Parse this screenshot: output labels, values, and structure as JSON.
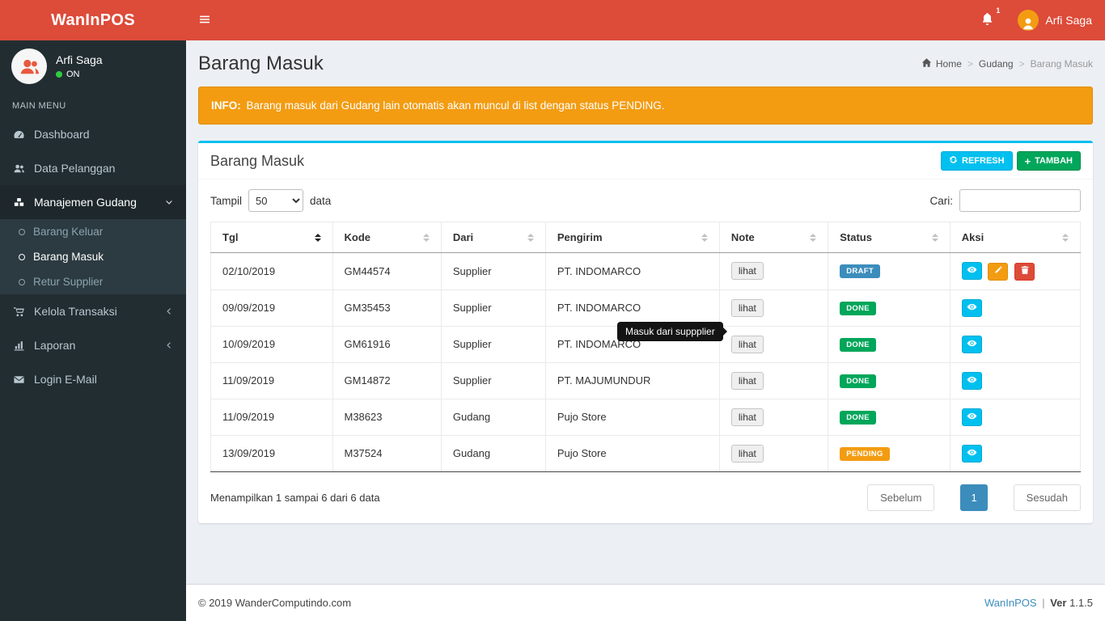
{
  "navbar": {
    "brand": "WanInPOS",
    "notification_count": "1",
    "user_name": "Arfi Saga"
  },
  "sidebar": {
    "user": {
      "name": "Arfi Saga",
      "status": "ON"
    },
    "section": "MAIN MENU",
    "items": [
      {
        "label": "Dashboard"
      },
      {
        "label": "Data Pelanggan"
      },
      {
        "label": "Manajemen Gudang"
      },
      {
        "label": "Kelola Transaksi"
      },
      {
        "label": "Laporan"
      },
      {
        "label": "Login E-Mail"
      }
    ],
    "gudang_children": [
      {
        "label": "Barang Keluar"
      },
      {
        "label": "Barang Masuk"
      },
      {
        "label": "Retur Supplier"
      }
    ]
  },
  "content": {
    "page_title": "Barang Masuk",
    "breadcrumb": {
      "home": "Home",
      "middle": "Gudang",
      "current": "Barang Masuk"
    },
    "alert": {
      "prefix": "INFO:",
      "text": "Barang masuk dari Gudang lain otomatis akan muncul di list dengan status PENDING."
    },
    "tooltip": "Masuk dari suppplier",
    "panel": {
      "title": "Barang Masuk",
      "refresh_label": "REFRESH",
      "tambah_label": "TAMBAH",
      "length_label": "Tampil",
      "length_value": "50",
      "length_suffix": "data",
      "search_label": "Cari:",
      "info": "Menampilkan 1 sampai 6 dari 6 data",
      "pagination": {
        "prev": "Sebelum",
        "current": "1",
        "next": "Sesudah"
      },
      "table": {
        "columns": [
          "Tgl",
          "Kode",
          "Dari",
          "Pengirim",
          "Note",
          "Status",
          "Aksi"
        ],
        "rows": [
          {
            "tgl": "02/10/2019",
            "kode": "GM44574",
            "dari": "Supplier",
            "pengirim": "PT. INDOMARCO",
            "note": "lihat",
            "status": "DRAFT",
            "status_color": "#3c8dbc"
          },
          {
            "tgl": "09/09/2019",
            "kode": "GM35453",
            "dari": "Supplier",
            "pengirim": "PT. INDOMARCO",
            "note": "lihat",
            "status": "DONE",
            "status_color": "#00a65a"
          },
          {
            "tgl": "10/09/2019",
            "kode": "GM61916",
            "dari": "Supplier",
            "pengirim": "PT. INDOMARCO",
            "note": "lihat",
            "status": "DONE",
            "status_color": "#00a65a"
          },
          {
            "tgl": "11/09/2019",
            "kode": "GM14872",
            "dari": "Supplier",
            "pengirim": "PT. MAJUMUNDUR",
            "note": "lihat",
            "status": "DONE",
            "status_color": "#00a65a"
          },
          {
            "tgl": "11/09/2019",
            "kode": "M38623",
            "dari": "Gudang",
            "pengirim": "Pujo Store",
            "note": "lihat",
            "status": "DONE",
            "status_color": "#00a65a"
          },
          {
            "tgl": "13/09/2019",
            "kode": "M37524",
            "dari": "Gudang",
            "pengirim": "Pujo Store",
            "note": "lihat",
            "status": "PENDING",
            "status_color": "#f39c12"
          }
        ]
      }
    }
  },
  "footer": {
    "copyright": "© 2019",
    "company": "WanderComputindo.com",
    "app": "WanInPOS",
    "divider": "|",
    "version_label": "Ver",
    "version": "1.1.5"
  },
  "colors": {
    "navbar_red": "#dd4b39",
    "sidebar_dark": "#222d32",
    "info_cyan": "#00c0ef",
    "success_green": "#00a65a",
    "warning_orange": "#f39c12",
    "primary_blue": "#3c8dbc",
    "danger_red": "#dd4b39"
  }
}
